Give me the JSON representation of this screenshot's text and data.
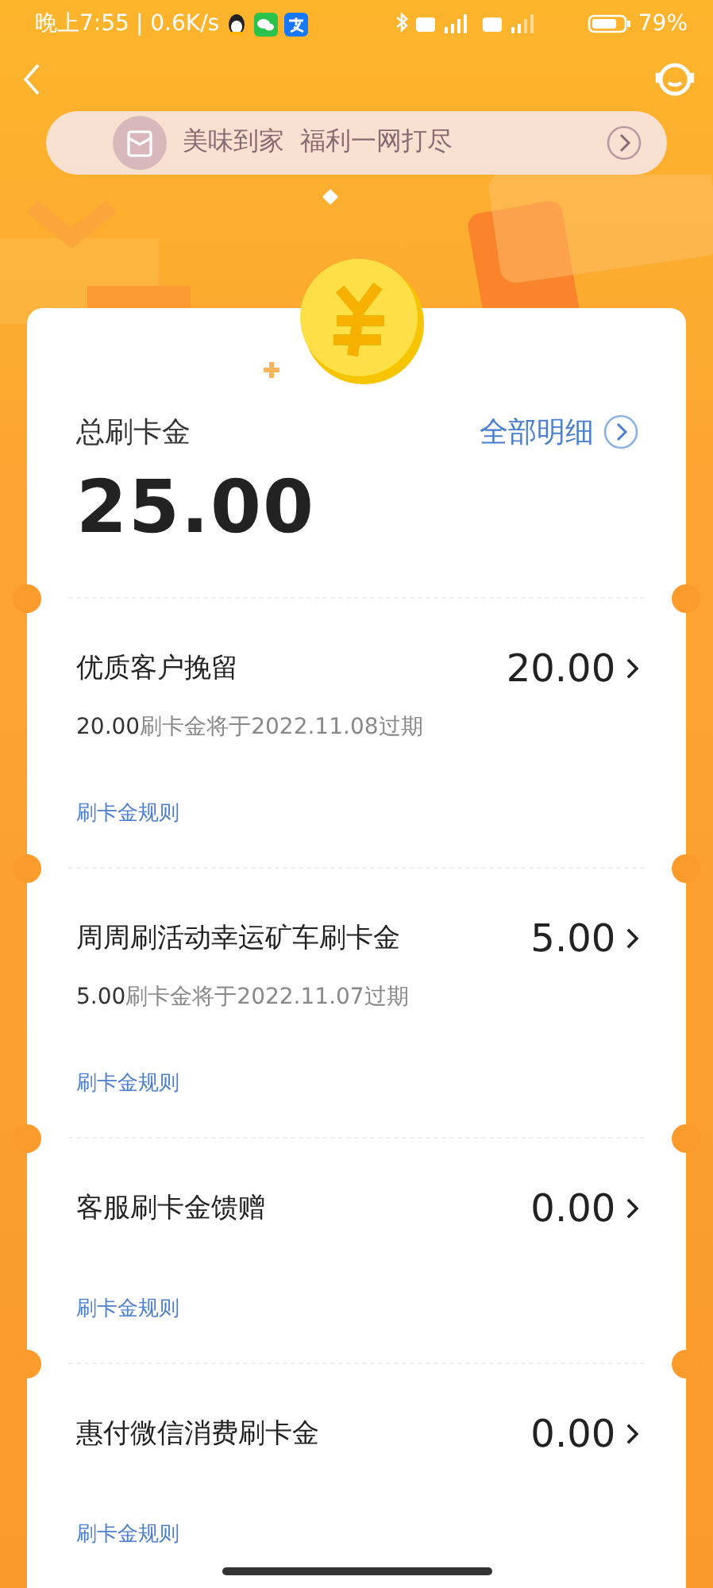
{
  "status_bar": {
    "time": "晚上7:55",
    "speed": "| 0.6K/s",
    "battery": "79%"
  },
  "banner": {
    "text": "美味到家  福利一网打尽"
  },
  "summary": {
    "label": "总刷卡金",
    "link": "全部明细",
    "total": "25.00"
  },
  "items": [
    {
      "title": "优质客户挽留",
      "amount": "20.00",
      "expiry_amount": "20.00",
      "expiry_text": "刷卡金将于2022.11.08过期",
      "link": "刷卡金规则"
    },
    {
      "title": "周周刷活动幸运矿车刷卡金",
      "amount": "5.00",
      "expiry_amount": "5.00",
      "expiry_text": "刷卡金将于2022.11.07过期",
      "link": "刷卡金规则"
    },
    {
      "title": "客服刷卡金馈赠",
      "amount": "0.00",
      "link": "刷卡金规则"
    },
    {
      "title": "惠付微信消费刷卡金",
      "amount": "0.00",
      "link": "刷卡金规则"
    }
  ]
}
